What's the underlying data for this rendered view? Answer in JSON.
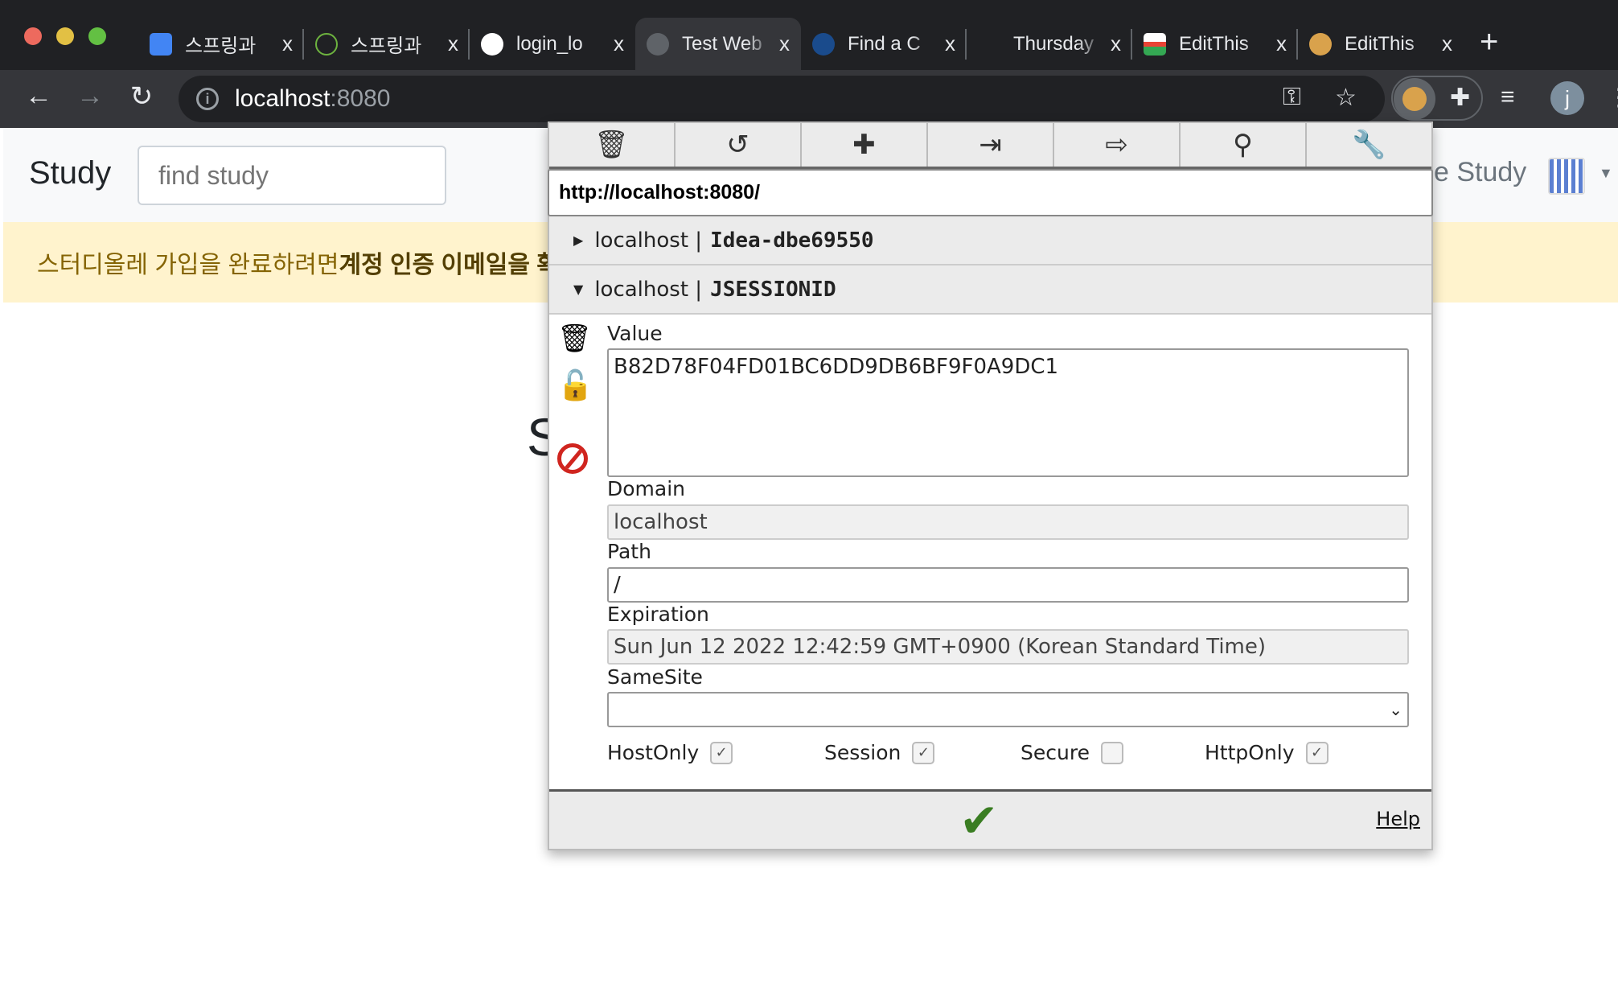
{
  "browser": {
    "tabs": [
      {
        "label": "스프링과",
        "icon": "docs-icon",
        "active": false
      },
      {
        "label": "스프링과",
        "icon": "spring-icon",
        "active": false
      },
      {
        "label": "login_lo",
        "icon": "github-icon",
        "active": false
      },
      {
        "label": "Test Web",
        "icon": "globe-icon",
        "active": true
      },
      {
        "label": "Find a C",
        "icon": "toastmasters-icon",
        "active": false
      },
      {
        "label": "Thursday",
        "icon": "meetup-icon",
        "active": false
      },
      {
        "label": "EditThis",
        "icon": "chrome-store-icon",
        "active": false
      },
      {
        "label": "EditThis",
        "icon": "cookie-icon",
        "active": false
      }
    ],
    "close_glyph": "x",
    "address_host": "localhost",
    "address_port": ":8080",
    "profile_initial": "j"
  },
  "page": {
    "brand": "Study",
    "search_placeholder": "find study",
    "banner_text": "스터디올레 가입을 완료하려면 ",
    "banner_bold": "계정 인증 이메일을 확",
    "nav_right": "e Study",
    "heading_partial": "S"
  },
  "cookie_editor": {
    "url": "http://localhost:8080/",
    "cookies": [
      {
        "domain": "localhost",
        "name": "Idea-dbe69550",
        "expanded": false
      },
      {
        "domain": "localhost",
        "name": "JSESSIONID",
        "expanded": true
      }
    ],
    "separator": "|",
    "fields": {
      "value_label": "Value",
      "value": "B82D78F04FD01BC6DD9DB6BF9F0A9DC1",
      "domain_label": "Domain",
      "domain": "localhost",
      "path_label": "Path",
      "path": "/",
      "expiration_label": "Expiration",
      "expiration": "Sun Jun 12 2022 12:42:59 GMT+0900 (Korean Standard Time)",
      "samesite_label": "SameSite",
      "samesite": ""
    },
    "flags": [
      {
        "label": "HostOnly",
        "checked": true
      },
      {
        "label": "Session",
        "checked": true
      },
      {
        "label": "Secure",
        "checked": false
      },
      {
        "label": "HttpOnly",
        "checked": true
      }
    ],
    "help_label": "Help",
    "accent": "#3a7d22"
  }
}
